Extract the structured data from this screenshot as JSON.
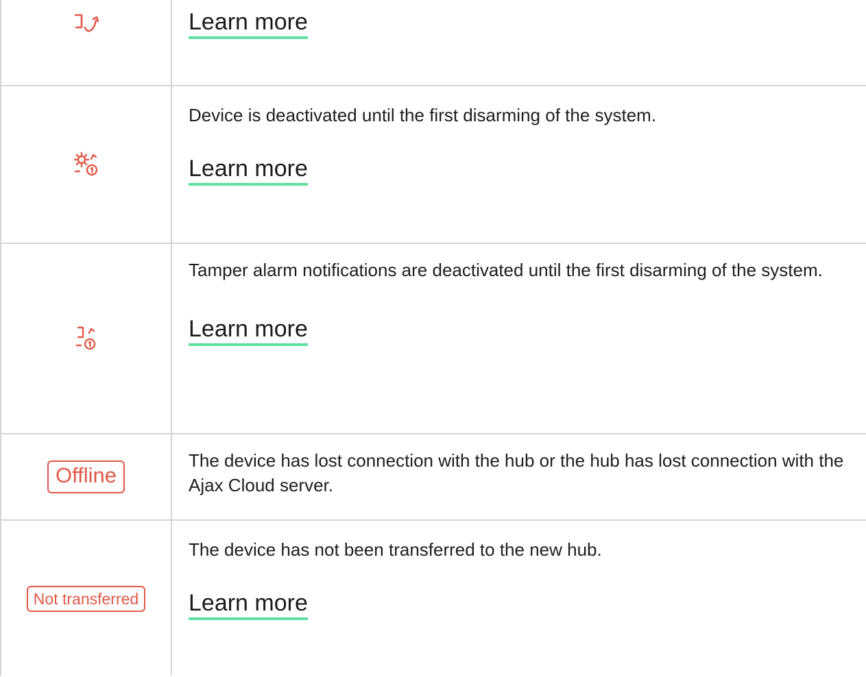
{
  "accent_color": "#e15848",
  "link_underline_color": "#5fe0a0",
  "border_color": "#d4d4d4",
  "rows": [
    {
      "icon": "tamper-arrow-icon",
      "description": "",
      "link": "Learn more"
    },
    {
      "icon": "gear-deactivated-until-disarm-icon",
      "description": "Device is deactivated until the first disarming of the system.",
      "link": "Learn more"
    },
    {
      "icon": "tamper-deactivated-until-disarm-icon",
      "description": "Tamper alarm notifications are deactivated until the first disarming of the system.",
      "link": "Learn more"
    },
    {
      "badge": "Offline",
      "description": "The device has lost connection with the hub or the hub has lost connection with the Ajax Cloud server."
    },
    {
      "badge": "Not transferred",
      "description": "The device has not been transferred to the new hub.",
      "link": "Learn more"
    }
  ]
}
